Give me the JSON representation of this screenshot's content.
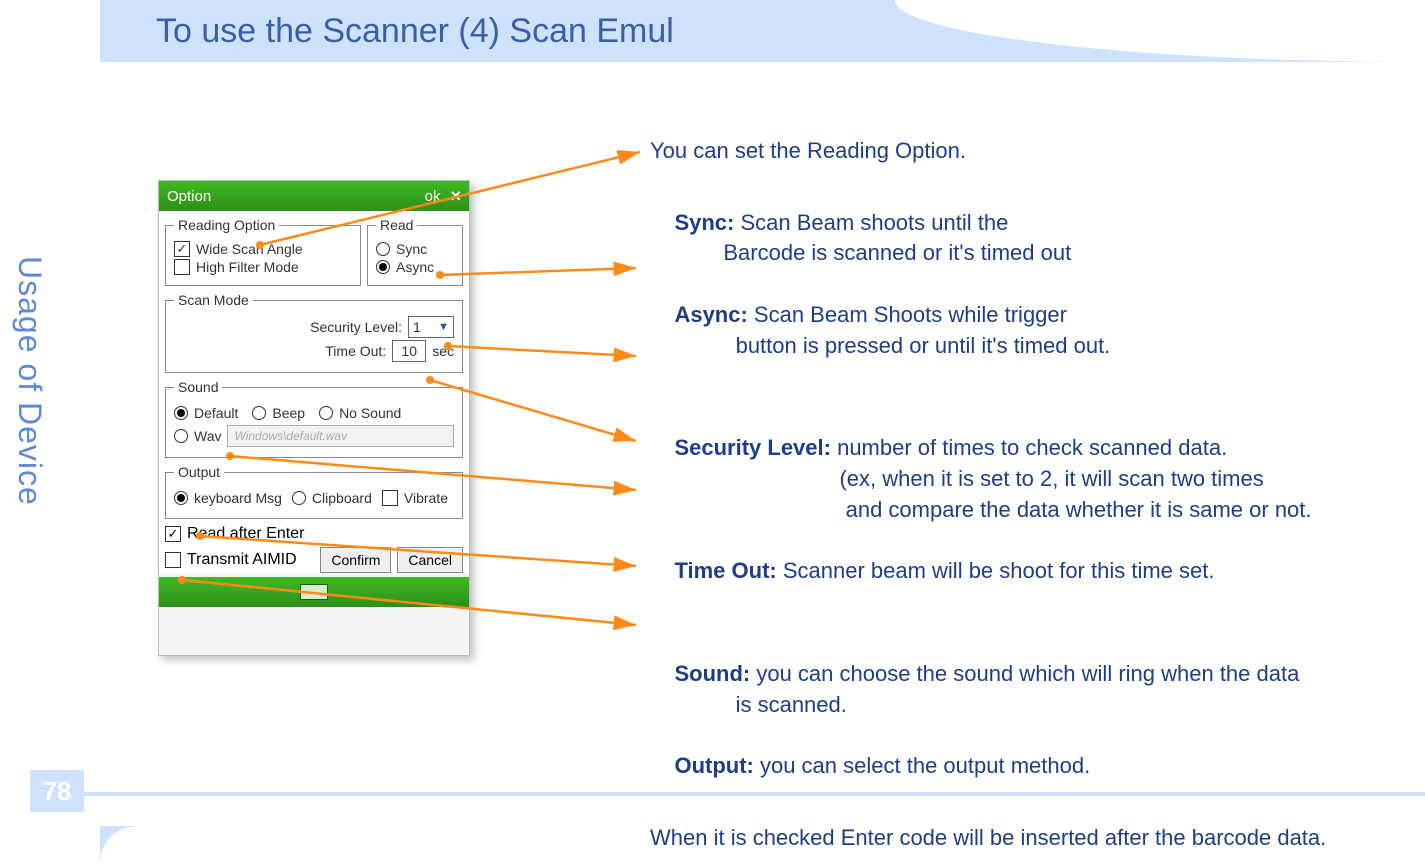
{
  "page": {
    "title": "To use the Scanner (4) Scan Emul",
    "sidebar_label": "Usage of Device",
    "page_number": "78"
  },
  "device": {
    "window_title": "Option",
    "ok": "ok",
    "close_symbol": "×",
    "groups": {
      "reading_option": {
        "legend": "Reading Option",
        "wide_scan_angle": "Wide Scan Angle",
        "high_filter_mode": "High Filter Mode"
      },
      "read": {
        "legend": "Read",
        "sync": "Sync",
        "async": "Async"
      },
      "scan_mode": {
        "legend": "Scan Mode",
        "security_label": "Security Level:",
        "security_value": "1",
        "timeout_label": "Time Out:",
        "timeout_value": "10",
        "timeout_unit": "sec"
      },
      "sound": {
        "legend": "Sound",
        "default": "Default",
        "beep": "Beep",
        "no_sound": "No Sound",
        "wav": "Wav",
        "wav_path": "Windows\\default.wav"
      },
      "output": {
        "legend": "Output",
        "keyboard_msg": "keyboard Msg",
        "clipboard": "Clipboard",
        "vibrate": "Vibrate"
      },
      "footer": {
        "read_after_enter": "Read after Enter",
        "transmit_aimid": "Transmit AIMID",
        "confirm": "Confirm",
        "cancel": "Cancel"
      }
    }
  },
  "expl": {
    "l1": "You can set the Reading Option.",
    "sync_label": "Sync:",
    "sync_text": " Scan Beam shoots until the\n            Barcode is scanned or it's timed out",
    "async_label": "Async:",
    "async_text": " Scan Beam Shoots while trigger\n              button is pressed or until it's timed out.",
    "sec_label": "Security Level:",
    "sec_text": " number of times to check scanned data.\n                               (ex, when it is set to 2, it will scan two times\n                                and compare the data whether it is same or not.",
    "to_label": "Time Out:",
    "to_text": " Scanner beam will be shoot for this time set.",
    "sound_label": "Sound:",
    "sound_text": " you can choose the sound which will ring when the data\n              is scanned.",
    "out_label": "Output:",
    "out_text": " you can select the output method.",
    "enter_text": "When it is checked Enter code will be inserted after the barcode data."
  }
}
